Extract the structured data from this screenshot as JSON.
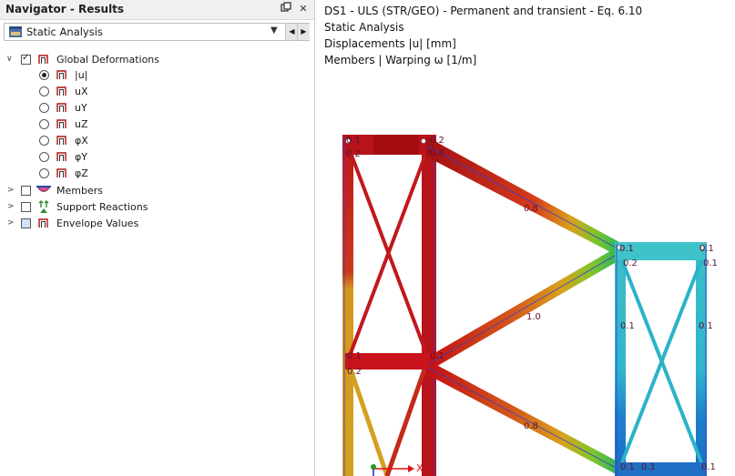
{
  "navigator": {
    "title": "Navigator - Results",
    "pin_icon": "pin-icon",
    "close_label": "✕",
    "analysis_type": "Static Analysis",
    "tree": {
      "global_deformations": {
        "label": "Global Deformations",
        "checked": true,
        "items": [
          {
            "label": "|u|",
            "selected": true
          },
          {
            "label": "uX",
            "selected": false
          },
          {
            "label": "uY",
            "selected": false
          },
          {
            "label": "uZ",
            "selected": false
          },
          {
            "label": "φX",
            "selected": false
          },
          {
            "label": "φY",
            "selected": false
          },
          {
            "label": "φZ",
            "selected": false
          }
        ]
      },
      "members": {
        "label": "Members",
        "checked": false
      },
      "support_reactions": {
        "label": "Support Reactions",
        "checked": false
      },
      "envelope_values": {
        "label": "Envelope Values",
        "checked": false
      }
    }
  },
  "header": {
    "line1": "DS1 - ULS (STR/GEO) - Permanent and transient - Eq. 6.10",
    "line2": "Static Analysis",
    "line3": "Displacements |u| [mm]",
    "line4": "Members | Warping ω [1/m]"
  },
  "model": {
    "labels": [
      "0.1",
      "0.2",
      "0.2",
      "0.6",
      "0.8",
      "1.0",
      "0.1",
      "0.2",
      "0.1",
      "0.8",
      "0.1",
      "0.2",
      "0.1",
      "0.1",
      "0.1",
      "0.1",
      "0.1",
      "0.1",
      "0.1"
    ],
    "axis_x_label": "X"
  },
  "colors": {
    "deep_red": "#c40f12",
    "orange": "#d9a11d",
    "green": "#3cc43a",
    "cyan": "#2bb9c9",
    "blue": "#1f6fc4"
  }
}
